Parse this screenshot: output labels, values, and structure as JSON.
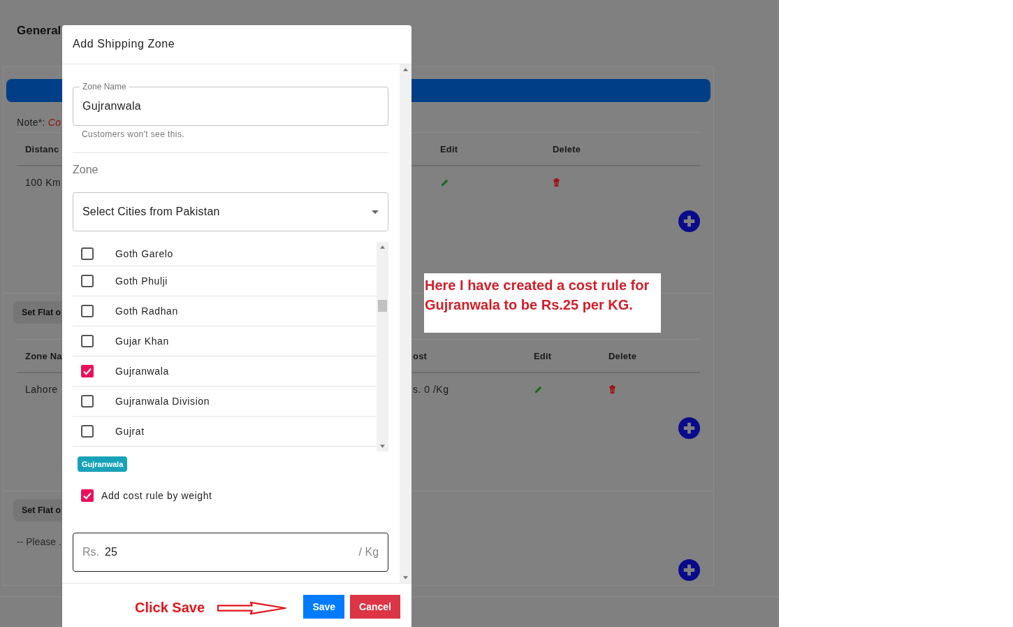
{
  "page": {
    "title": "General",
    "note_label": "Note*:",
    "note_text": "Co",
    "distance_table": {
      "columns": [
        "Distanc",
        "Edit",
        "Delete"
      ],
      "rows": [
        {
          "distance": "100 Km"
        }
      ]
    },
    "zone_section": {
      "button": "Set Flat o",
      "columns": [
        "Zone Na",
        "ost",
        "Edit",
        "Delete"
      ],
      "rows": [
        {
          "zone": "Lahore",
          "cost": "s. 0 /Kg"
        }
      ]
    },
    "third_section": {
      "button": "Set Flat o",
      "message": "-- Please ."
    }
  },
  "modal": {
    "title": "Add Shipping Zone",
    "zone_name": {
      "label": "Zone Name",
      "value": "Gujranwala",
      "helper": "Customers won't see this."
    },
    "zone_label": "Zone",
    "select": {
      "placeholder": "Select Cities from Pakistan"
    },
    "cities": [
      {
        "label": "Goth Garelo",
        "checked": false
      },
      {
        "label": "Goth Phulji",
        "checked": false
      },
      {
        "label": "Goth Radhan",
        "checked": false
      },
      {
        "label": "Gujar Khan",
        "checked": false
      },
      {
        "label": "Gujranwala",
        "checked": true
      },
      {
        "label": "Gujranwala Division",
        "checked": false
      },
      {
        "label": "Gujrat",
        "checked": false
      }
    ],
    "chips": [
      {
        "label": "Gujranwala"
      }
    ],
    "weight_rule": {
      "label": "Add cost rule by weight",
      "checked": true
    },
    "rate": {
      "prefix": "Rs.",
      "value": "25",
      "suffix": "/ Kg"
    },
    "buttons": [
      {
        "label": "Save",
        "kind": "primary"
      },
      {
        "label": "Cancel",
        "kind": "danger"
      }
    ]
  },
  "annotations": [
    {
      "kind": "callout",
      "text": "Here I have created a cost rule for Gujranwala to be Rs.25 per KG."
    },
    {
      "kind": "arrow-label",
      "text": "Click Save"
    }
  ]
}
